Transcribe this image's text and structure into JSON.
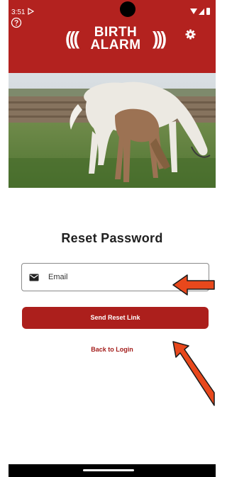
{
  "status_bar": {
    "time": "3:51"
  },
  "logo": {
    "waves_left": "(((",
    "line1": "BIRTH",
    "line2": "ALARM",
    "waves_right": ")))"
  },
  "icons": {
    "help": "help-circle-icon",
    "settings": "gear-icon",
    "email": "mail-icon",
    "play": "play-icon",
    "signal": "signal-icon",
    "battery": "battery-icon"
  },
  "form": {
    "title": "Reset Password",
    "email_placeholder": "Email",
    "send_button_label": "Send Reset Link",
    "back_link_label": "Back to Login"
  },
  "colors": {
    "brand_red": "#b3221f",
    "button_red": "#ac1f1c",
    "annotation_arrow": "#e8481c"
  }
}
